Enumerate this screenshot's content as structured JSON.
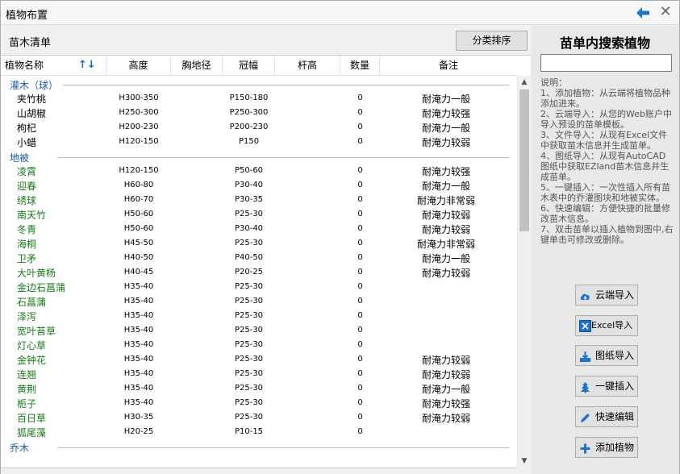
{
  "window": {
    "title": "植物布置"
  },
  "left": {
    "list_title": "苗木清单",
    "sort_button": "分类排序"
  },
  "table": {
    "headers": [
      "植物名称",
      "高度",
      "胸地径",
      "冠幅",
      "杆高",
      "数量",
      "备注"
    ],
    "sort_arrows": "↑↓",
    "groups": [
      {
        "name": "灌木（球）",
        "color": "default",
        "rows": [
          {
            "name": "夹竹桃",
            "height": "H300-350",
            "crown": "P150-180",
            "qty": "0",
            "note": "耐淹力一般"
          },
          {
            "name": "山胡椒",
            "height": "H250-300",
            "crown": "P250-300",
            "qty": "0",
            "note": "耐淹力较强"
          },
          {
            "name": "枸杞",
            "height": "H200-230",
            "crown": "P200-230",
            "qty": "0",
            "note": "耐淹力一般"
          },
          {
            "name": "小蜡",
            "height": "H120-150",
            "crown": "P150",
            "qty": "0",
            "note": "耐淹力较弱"
          }
        ]
      },
      {
        "name": "地被",
        "color": "green",
        "rows": [
          {
            "name": "凌霄",
            "height": "H120-150",
            "crown": "P50-60",
            "qty": "0",
            "note": "耐淹力较强"
          },
          {
            "name": "迎春",
            "height": "H60-80",
            "crown": "P30-40",
            "qty": "0",
            "note": "耐淹力一般"
          },
          {
            "name": "绣球",
            "height": "H60-70",
            "crown": "P30-35",
            "qty": "0",
            "note": "耐淹力非常弱"
          },
          {
            "name": "南天竹",
            "height": "H50-60",
            "crown": "P25-30",
            "qty": "0",
            "note": "耐淹力较弱"
          },
          {
            "name": "冬青",
            "height": "H50-60",
            "crown": "P30-40",
            "qty": "0",
            "note": "耐淹力较弱"
          },
          {
            "name": "海桐",
            "height": "H45-50",
            "crown": "P25-30",
            "qty": "0",
            "note": "耐淹力非常弱"
          },
          {
            "name": "卫矛",
            "height": "H40-50",
            "crown": "P40-50",
            "qty": "0",
            "note": "耐淹力一般"
          },
          {
            "name": "大叶黄杨",
            "height": "H40-45",
            "crown": "P20-25",
            "qty": "0",
            "note": "耐淹力较弱"
          },
          {
            "name": "金边石菖蒲",
            "height": "H35-40",
            "crown": "P25-30",
            "qty": "0",
            "note": ""
          },
          {
            "name": "石菖蒲",
            "height": "H35-40",
            "crown": "P25-30",
            "qty": "0",
            "note": ""
          },
          {
            "name": "泽泻",
            "height": "H35-40",
            "crown": "P25-30",
            "qty": "0",
            "note": ""
          },
          {
            "name": "宽叶苔草",
            "height": "H35-40",
            "crown": "P25-30",
            "qty": "0",
            "note": ""
          },
          {
            "name": "灯心草",
            "height": "H35-40",
            "crown": "P25-30",
            "qty": "0",
            "note": ""
          },
          {
            "name": "金钟花",
            "height": "H35-40",
            "crown": "P25-30",
            "qty": "0",
            "note": "耐淹力较弱"
          },
          {
            "name": "连翘",
            "height": "H35-40",
            "crown": "P25-30",
            "qty": "0",
            "note": "耐淹力较弱"
          },
          {
            "name": "黄荆",
            "height": "H35-40",
            "crown": "P25-30",
            "qty": "0",
            "note": "耐淹力一般"
          },
          {
            "name": "栀子",
            "height": "H35-40",
            "crown": "P25-30",
            "qty": "0",
            "note": "耐淹力较强"
          },
          {
            "name": "百日草",
            "height": "H30-35",
            "crown": "P25-30",
            "qty": "0",
            "note": "耐淹力较弱"
          },
          {
            "name": "狐尾藻",
            "height": "H20-25",
            "crown": "P10-15",
            "qty": "0",
            "note": ""
          }
        ]
      },
      {
        "name": "乔木",
        "color": "default",
        "rows": []
      }
    ]
  },
  "right": {
    "title": "苗单内搜索植物",
    "search_value": "",
    "help_lines": [
      "说明：",
      "1、添加植物：从云端将植物品种添加进来。",
      "2、云端导入：从您的Web账户中导入预设的苗单模板。",
      "3、文件导入：从现有Excel文件中获取苗木信息并生成苗单。",
      "4、图纸导入：从现有AutoCAD图纸中获取EZland苗木信息并生成苗单。",
      "5、一键插入：一次性插入所有苗木表中的乔灌图块和地被实体。",
      "6、快速编辑：方便快捷的批量修改苗木信息。",
      "7、双击苗单以插入植物到图中,右键单击可修改或删除。"
    ],
    "buttons": {
      "cloud_import": "云端导入",
      "excel_import": "Excel导入",
      "drawing_import": "图纸导入",
      "one_click_insert": "一键插入",
      "quick_edit": "快速编辑",
      "add_plant": "添加植物"
    }
  }
}
